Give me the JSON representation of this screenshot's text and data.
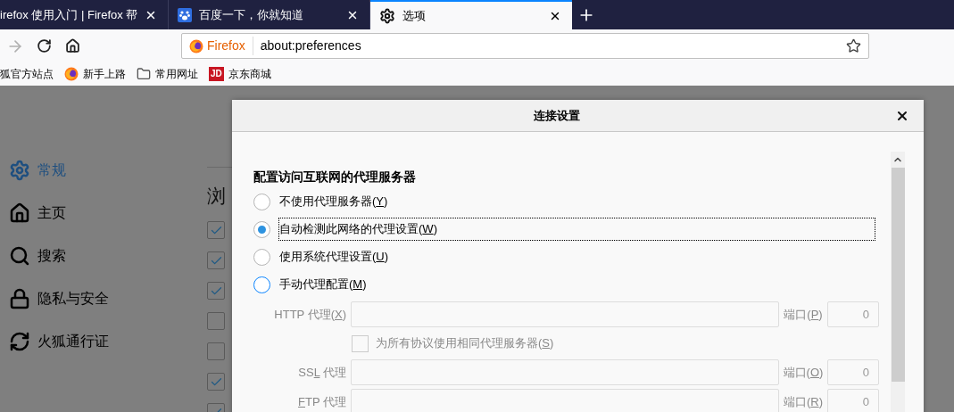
{
  "tabs": [
    {
      "title": "irefox 使用入门 | Firefox 帮",
      "selected": false
    },
    {
      "title": "百度一下，你就知道",
      "selected": false
    },
    {
      "title": "选项",
      "selected": true
    }
  ],
  "toolbar": {
    "identity": "Firefox",
    "url": "about:preferences"
  },
  "bookmarks": [
    {
      "label": "狐官方站点"
    },
    {
      "label": "新手上路"
    },
    {
      "label": "常用网址"
    },
    {
      "label": "京东商城",
      "badge": "JD"
    }
  ],
  "sidebar": {
    "items": [
      {
        "label": "常规",
        "selected": true
      },
      {
        "label": "主页",
        "selected": false
      },
      {
        "label": "搜索",
        "selected": false
      },
      {
        "label": "隐私与安全",
        "selected": false
      },
      {
        "label": "火狐通行证",
        "selected": false
      }
    ]
  },
  "page": {
    "heading": "浏",
    "checkboxes": [
      {
        "checked": true
      },
      {
        "checked": true
      },
      {
        "checked": true
      },
      {
        "checked": false
      },
      {
        "checked": false
      },
      {
        "checked": true
      },
      {
        "checked": true
      }
    ]
  },
  "dialog": {
    "title": "连接设置",
    "heading": "配置访问互联网的代理服务器",
    "options": [
      {
        "label": "不使用代理服务器(",
        "key": "Y",
        "end": ")",
        "selected": false,
        "focused": false
      },
      {
        "label": "自动检测此网络的代理设置(",
        "key": "W",
        "end": ")",
        "selected": true,
        "focused": true
      },
      {
        "label": "使用系统代理设置(",
        "key": "U",
        "end": ")",
        "selected": false,
        "focused": false
      },
      {
        "label": "手动代理配置(",
        "key": "M",
        "end": ")",
        "selected": false,
        "focused": false
      }
    ],
    "proxies": [
      {
        "kind": "field",
        "label": "HTTP 代理(",
        "key": "X",
        "end": ")",
        "port_label": "端口(",
        "port_key": "P",
        "port_end": ")",
        "port": "0"
      },
      {
        "kind": "checkbox",
        "label": "为所有协议使用相同代理服务器(",
        "key": "S",
        "end": ")",
        "checked": false
      },
      {
        "kind": "field",
        "label": "SS",
        "key": "L",
        "end": " 代理",
        "port_label": "端口(",
        "port_key": "O",
        "port_end": ")",
        "port": "0"
      },
      {
        "kind": "field",
        "key": "F",
        "end": "TP 代理",
        "port_label": "端口(",
        "port_key": "R",
        "port_end": ")",
        "port": "0"
      }
    ]
  }
}
